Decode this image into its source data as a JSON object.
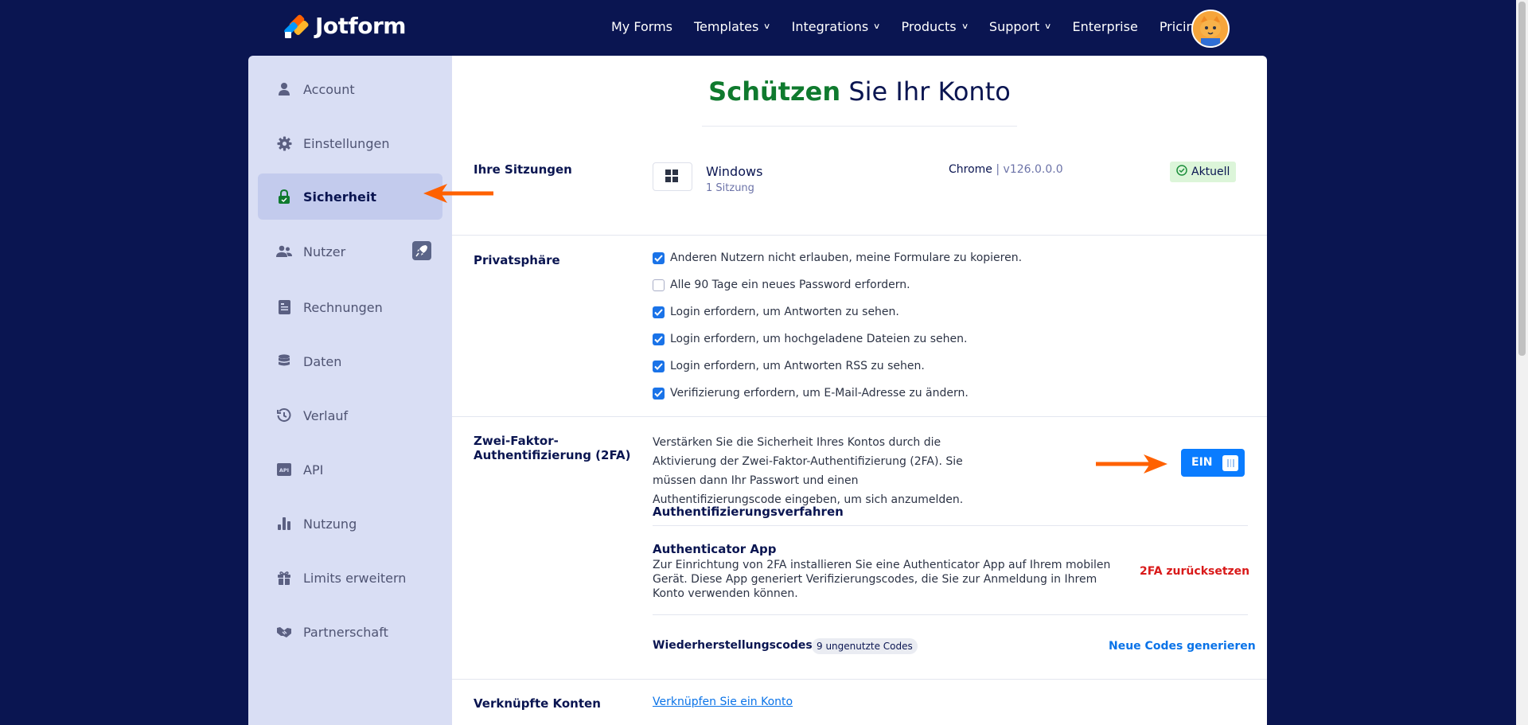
{
  "colors": {
    "navy": "#0a1551",
    "accent_orange": "#ff6100",
    "green": "#0f7a2e",
    "blue": "#0a7cff",
    "danger": "#d91a1a"
  },
  "brand": {
    "name": "Jotform"
  },
  "nav": [
    {
      "label": "My Forms",
      "dropdown": false
    },
    {
      "label": "Templates",
      "dropdown": true
    },
    {
      "label": "Integrations",
      "dropdown": true
    },
    {
      "label": "Products",
      "dropdown": true
    },
    {
      "label": "Support",
      "dropdown": true
    },
    {
      "label": "Enterprise",
      "dropdown": false
    },
    {
      "label": "Pricing",
      "dropdown": false
    }
  ],
  "sidebar": {
    "items": [
      {
        "label": "Account",
        "icon": "user-icon"
      },
      {
        "label": "Einstellungen",
        "icon": "gear-icon"
      },
      {
        "label": "Sicherheit",
        "icon": "lock-icon",
        "active": true
      },
      {
        "label": "Nutzer",
        "icon": "users-icon"
      },
      {
        "label": "Rechnungen",
        "icon": "invoice-icon"
      },
      {
        "label": "Daten",
        "icon": "database-icon"
      },
      {
        "label": "Verlauf",
        "icon": "history-icon"
      },
      {
        "label": "API",
        "icon": "api-icon"
      },
      {
        "label": "Nutzung",
        "icon": "bar-chart-icon"
      },
      {
        "label": "Limits erweitern",
        "icon": "gift-icon"
      },
      {
        "label": "Partnerschaft",
        "icon": "handshake-icon"
      }
    ]
  },
  "page": {
    "title_highlight": "Schützen",
    "title_rest": "Sie Ihr Konto"
  },
  "sessions": {
    "label": "Ihre Sitzungen",
    "os": "Windows",
    "count": "1 Sitzung",
    "browser": "Chrome",
    "separator": "|",
    "version": "v126.0.0.0",
    "status": "Aktuell"
  },
  "privacy": {
    "label": "Privatsphäre",
    "options": [
      {
        "text": "Anderen Nutzern nicht erlauben, meine Formulare zu kopieren.",
        "checked": true
      },
      {
        "text": "Alle 90 Tage ein neues Password erfordern.",
        "checked": false
      },
      {
        "text": "Login erfordern, um Antworten zu sehen.",
        "checked": true
      },
      {
        "text": "Login erfordern, um hochgeladene Dateien zu sehen.",
        "checked": true
      },
      {
        "text": "Login erfordern, um Antworten RSS zu sehen.",
        "checked": true
      },
      {
        "text": "Verifizierung erfordern, um E-Mail-Adresse zu ändern.",
        "checked": true
      }
    ]
  },
  "two_factor": {
    "label_line1": "Zwei-Faktor-",
    "label_line2": "Authentifizierung (2FA)",
    "description": "Verstärken Sie die Sicherheit Ihres Kontos durch die Aktivierung der Zwei-Faktor-Authentifizierung (2FA). Sie müssen dann Ihr Passwort und einen Authentifizierungscode eingeben, um sich anzumelden.",
    "toggle_label": "EIN",
    "enabled": true,
    "methods_heading": "Authentifizierungsverfahren",
    "app_title": "Authenticator App",
    "app_description": "Zur Einrichtung von 2FA installieren Sie eine Authenticator App auf Ihrem mobilen Gerät. Diese App generiert Verifizierungscodes, die Sie zur Anmeldung in Ihrem Konto verwenden können.",
    "reset_link": "2FA zurücksetzen",
    "recovery_title": "Wiederherstellungscodes",
    "recovery_badge": "9 ungenutzte Codes",
    "regenerate_link": "Neue Codes generieren"
  },
  "linked": {
    "label": "Verknüpfte Konten",
    "link": "Verknüpfen Sie ein Konto"
  }
}
